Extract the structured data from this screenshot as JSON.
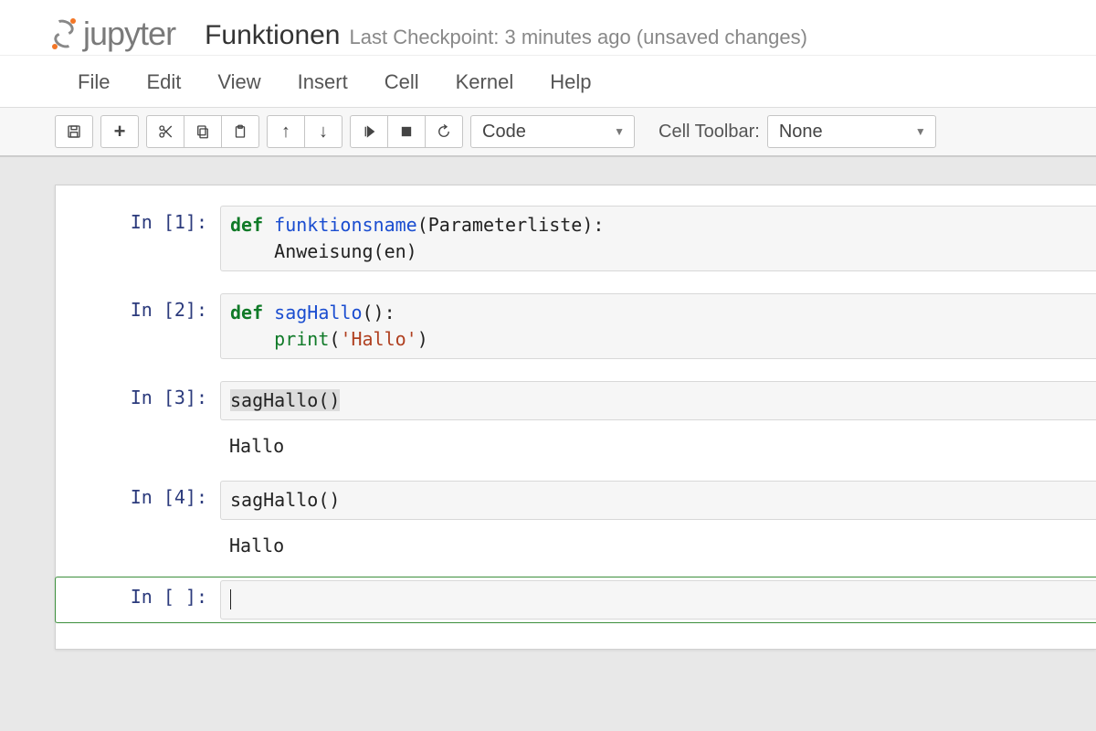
{
  "logo": {
    "text": "jupyter"
  },
  "notebook_name": "Funktionen",
  "checkpoint": "Last Checkpoint: 3 minutes ago (unsaved changes)",
  "menubar": [
    "File",
    "Edit",
    "View",
    "Insert",
    "Cell",
    "Kernel",
    "Help"
  ],
  "toolbar": {
    "cell_type_select": "Code",
    "cell_toolbar_label": "Cell Toolbar:",
    "cell_toolbar_select": "None"
  },
  "cells": [
    {
      "prompt": "In [1]:",
      "kind": "code",
      "tokens": [
        {
          "t": "def ",
          "c": "kw"
        },
        {
          "t": "funktionsname",
          "c": "fn"
        },
        {
          "t": "(Parameterliste):\n    Anweisung(en)",
          "c": ""
        }
      ]
    },
    {
      "prompt": "In [2]:",
      "kind": "code",
      "tokens": [
        {
          "t": "def ",
          "c": "kw"
        },
        {
          "t": "sagHallo",
          "c": "fn"
        },
        {
          "t": "():\n    ",
          "c": ""
        },
        {
          "t": "print",
          "c": "bi"
        },
        {
          "t": "(",
          "c": ""
        },
        {
          "t": "'Hallo'",
          "c": "str"
        },
        {
          "t": ")",
          "c": ""
        }
      ]
    },
    {
      "prompt": "In [3]:",
      "kind": "code",
      "tokens": [
        {
          "t": "sagHallo()",
          "c": "hl"
        }
      ],
      "output": "Hallo"
    },
    {
      "prompt": "In [4]:",
      "kind": "code",
      "tokens": [
        {
          "t": "sagHallo()",
          "c": ""
        }
      ],
      "output": "Hallo"
    },
    {
      "prompt": "In [ ]:",
      "kind": "code",
      "selected": true,
      "tokens": [],
      "cursor": true
    }
  ]
}
